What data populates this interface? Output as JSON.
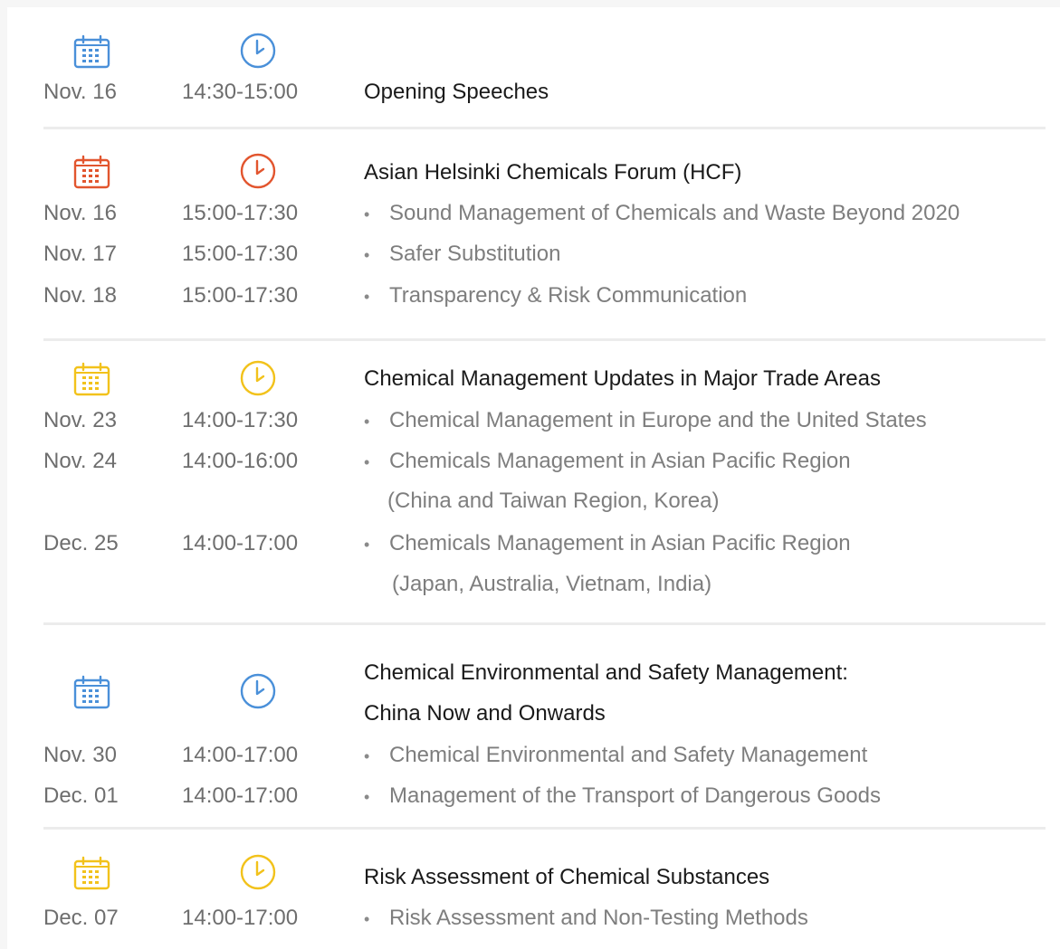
{
  "colors": {
    "blue": "#4a90d9",
    "red": "#e2552e",
    "yellow": "#f2c21b"
  },
  "icons": {
    "calendar": "calendar-icon",
    "clock": "clock-icon"
  },
  "sessions": [
    {
      "color": "blue",
      "title_lines": [
        "Opening Speeches"
      ],
      "rows": [
        {
          "date": "Nov. 16",
          "time": "14:30-15:00"
        }
      ]
    },
    {
      "color": "red",
      "title_lines": [
        "Asian Helsinki Chemicals Forum (HCF)"
      ],
      "rows": [
        {
          "date": "Nov. 16",
          "time": "15:00-17:30",
          "item": "Sound Management of Chemicals and Waste Beyond 2020"
        },
        {
          "date": "Nov. 17",
          "time": "15:00-17:30",
          "item": "Safer Substitution"
        },
        {
          "date": "Nov. 18",
          "time": "15:00-17:30",
          "item": "Transparency & Risk Communication"
        }
      ]
    },
    {
      "color": "yellow",
      "title_lines": [
        "Chemical Management Updates in Major Trade Areas"
      ],
      "rows": [
        {
          "date": "Nov. 23",
          "time": "14:00-17:30",
          "item": "Chemical Management in Europe and the United States"
        },
        {
          "date": "Nov. 24",
          "time": "14:00-16:00",
          "item": "Chemicals Management in Asian Pacific Region",
          "item_cont": "(China and Taiwan Region, Korea)"
        },
        {
          "date": "Dec. 25",
          "time": "14:00-17:00",
          "item": "Chemicals Management in Asian Pacific Region",
          "item_cont": "(Japan, Australia, Vietnam, India)"
        }
      ]
    },
    {
      "color": "blue",
      "title_lines": [
        "Chemical Environmental and Safety Management:",
        "China Now and Onwards"
      ],
      "rows": [
        {
          "date": "Nov. 30",
          "time": "14:00-17:00",
          "item": "Chemical Environmental and Safety Management"
        },
        {
          "date": "Dec. 01",
          "time": "14:00-17:00",
          "item": "Management of the Transport of  Dangerous Goods"
        }
      ]
    },
    {
      "color": "yellow",
      "title_lines": [
        "Risk Assessment of Chemical Substances"
      ],
      "rows": [
        {
          "date": "Dec. 07",
          "time": "14:00-17:00",
          "item": "Risk Assessment and Non-Testing Methods"
        }
      ]
    }
  ]
}
